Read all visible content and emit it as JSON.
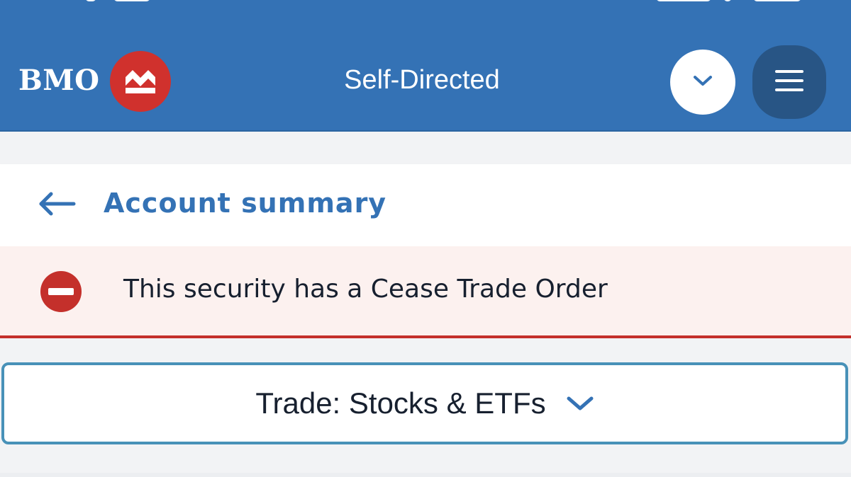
{
  "header": {
    "brand_name": "BMO",
    "title": "Self-Directed",
    "logo_icon": "bmo-roundel-icon",
    "dropdown_icon": "chevron-down-icon",
    "menu_icon": "hamburger-menu-icon",
    "background_color": "#3472b5",
    "logo_color": "#d0312d"
  },
  "back_link": {
    "label": "Account summary",
    "icon": "arrow-left-icon",
    "color": "#3472b5"
  },
  "alert": {
    "message": "This security has a Cease Trade Order",
    "icon": "no-entry-icon",
    "severity_color": "#c4302b",
    "background_color": "#fcf1ef"
  },
  "trade_select": {
    "label": "Trade: Stocks & ETFs",
    "icon": "chevron-down-icon",
    "border_color": "#4891b8"
  }
}
